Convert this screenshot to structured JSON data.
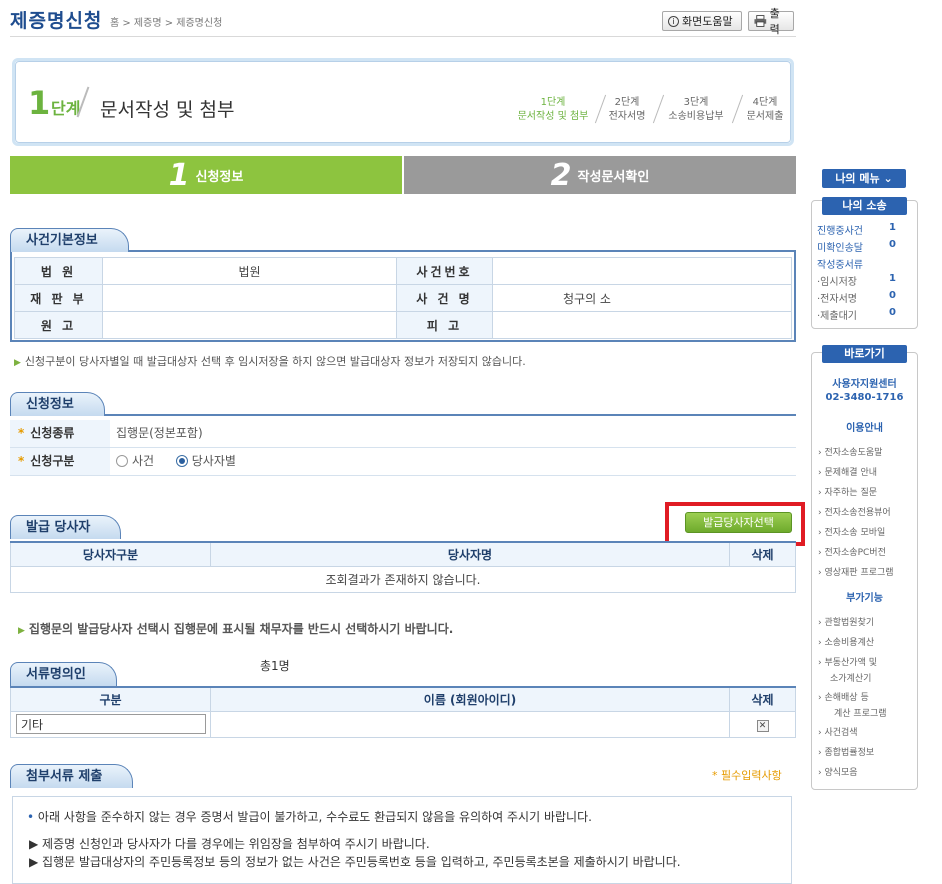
{
  "header": {
    "title": "제증명신청",
    "breadcrumb": "홈 > 제증명 > 제증명신청",
    "help_label": "화면도움말",
    "print_label": "출력"
  },
  "step": {
    "num": "1",
    "unit": "단계",
    "name": "문서작성 및 첨부",
    "steps": [
      {
        "t": "1단계",
        "d": "문서작성 및 첨부"
      },
      {
        "t": "2단계",
        "d": "전자서명"
      },
      {
        "t": "3단계",
        "d": "소송비용납부"
      },
      {
        "t": "4단계",
        "d": "문서제출"
      }
    ]
  },
  "tabs": [
    {
      "num": "1",
      "label": "신청정보"
    },
    {
      "num": "2",
      "label": "작성문서확인"
    }
  ],
  "case_info": {
    "title": "사건기본정보",
    "court_label": "법 원",
    "court_value": "법원",
    "case_no_label": "사건번호",
    "case_no_value": "",
    "judge_label": "재 판 부",
    "judge_value": "",
    "case_name_label": "사 건 명",
    "case_name_value": "청구의 소",
    "plaintiff_label": "원 고",
    "plaintiff_value": "",
    "defendant_label": "피 고",
    "defendant_value": ""
  },
  "notice1": "신청구분이 당사자별일 때 발급대상자 선택 후 임시저장을 하지 않으면 발급대상자 정보가 저장되지 않습니다.",
  "apply": {
    "title": "신청정보",
    "type_label": "신청종류",
    "type_value": "집행문(정본포함)",
    "div_label": "신청구분",
    "opt_case": "사건",
    "opt_party": "당사자별"
  },
  "issue": {
    "title": "발급 당사자",
    "select_button": "발급당사자선택",
    "columns": [
      "당사자구분",
      "당사자명",
      "삭제"
    ],
    "empty": "조회결과가 존재하지 않습니다."
  },
  "warning": "집행문의 발급당사자 선택시 집행문에 표시될 채무자를 반드시 선택하시기 바랍니다.",
  "signer": {
    "title": "서류명의인",
    "total": "총1명",
    "columns": [
      "구분",
      "이름 (회원아이디)",
      "삭제"
    ],
    "row_value": "기타"
  },
  "attach": {
    "title": "첨부서류 제출",
    "required_note": "* 필수입력사항",
    "line1": "아래 사항을 준수하지 않는 경우 증명서 발급이 불가하고, 수수료도 환급되지 않음을 유의하여 주시기 바랍니다.",
    "line2": "▶ 제증명 신청인과 당사자가 다를 경우에는 위임장을 첨부하여 주시기 바랍니다.",
    "line3": "▶ 집행문 발급대상자의 주민등록정보 등의 정보가 없는 사건은 주민등록번호 등을 입력하고, 주민등록초본을 제출하시기 바랍니다."
  },
  "side": {
    "my_menu": "나의 메뉴",
    "my_case": "나의 소송",
    "items": [
      {
        "label": "진행중사건",
        "count": "1"
      },
      {
        "label": "미확인송달",
        "count": "0"
      },
      {
        "label": "작성중서류",
        "count": ""
      },
      {
        "label": "·임시저장",
        "count": "1"
      },
      {
        "label": "·전자서명",
        "count": "0"
      },
      {
        "label": "·제출대기",
        "count": "0"
      }
    ],
    "shortcut": "바로가기",
    "support_center": "사용자지원센터",
    "phone": "02-3480-1716",
    "guide_title": "이용안내",
    "guide_links": [
      "전자소송도움말",
      "문제해결 안내",
      "자주하는 질문",
      "전자소송전용뷰어",
      "전자소송 모바일",
      "전자소송PC버전",
      "영상재판 프로그램"
    ],
    "extra_title": "부가기능",
    "extra_links": [
      "관할법원찾기",
      "소송비용계산",
      "부동산가액 및",
      "소가계산기",
      "손해배상 등",
      "계산 프로그램",
      "사건검색",
      "종합법률정보",
      "양식모음"
    ]
  }
}
